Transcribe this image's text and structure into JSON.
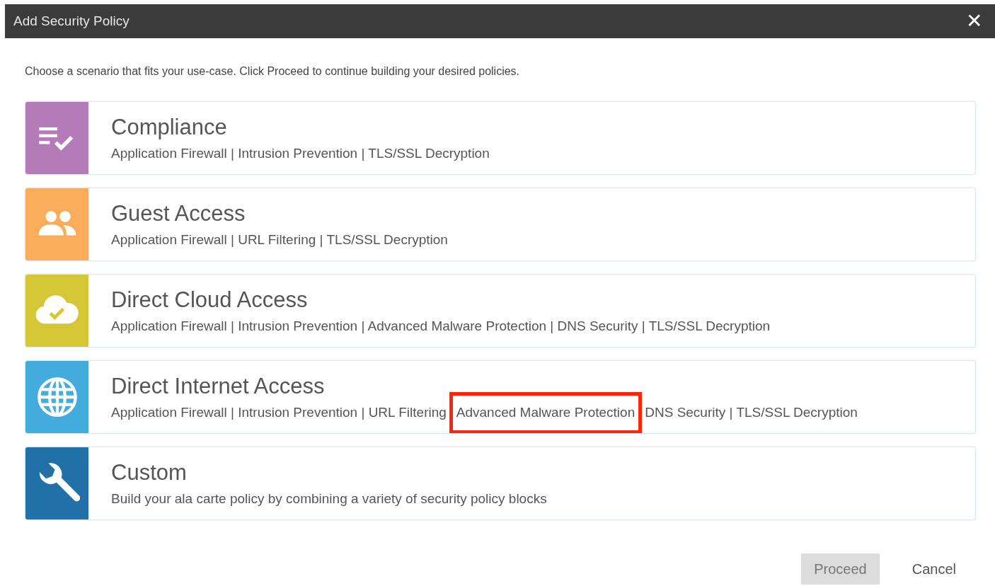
{
  "window": {
    "title": "Add Security Policy",
    "close": "✕"
  },
  "instruction": "Choose a scenario that fits your use-case. Click Proceed to continue building your desired policies.",
  "scenarios": [
    {
      "kind": "checklist",
      "color": "#b57ab8",
      "title": "Compliance",
      "segments": [
        {
          "text": "Application Firewall | Intrusion Prevention | TLS/SSL Decryption",
          "highlighted": false
        }
      ]
    },
    {
      "kind": "people",
      "color": "#f9ad5b",
      "title": "Guest Access",
      "segments": [
        {
          "text": "Application Firewall | URL Filtering | TLS/SSL Decryption",
          "highlighted": false
        }
      ]
    },
    {
      "kind": "cloud",
      "color": "#d4c634",
      "title": "Direct Cloud Access",
      "segments": [
        {
          "text": "Application Firewall | Intrusion Prevention | Advanced Malware Protection | DNS Security | TLS/SSL Decryption",
          "highlighted": false
        }
      ]
    },
    {
      "kind": "globe",
      "color": "#42acdc",
      "title": "Direct Internet Access",
      "segments": [
        {
          "text": "Application Firewall | Intrusion Prevention | URL Filtering",
          "highlighted": false
        },
        {
          "text": "Advanced Malware Protection",
          "highlighted": true
        },
        {
          "text": "DNS Security | TLS/SSL Decryption",
          "highlighted": false
        }
      ]
    },
    {
      "kind": "wrench",
      "color": "#2170a8",
      "title": "Custom",
      "segments": [
        {
          "text": "Build your ala carte policy by combining a variety of security policy blocks",
          "highlighted": false
        }
      ]
    }
  ],
  "buttons": [
    {
      "label": "Proceed",
      "kind": "primary",
      "disabled": true
    },
    {
      "label": "Cancel",
      "kind": "text",
      "disabled": false
    }
  ]
}
